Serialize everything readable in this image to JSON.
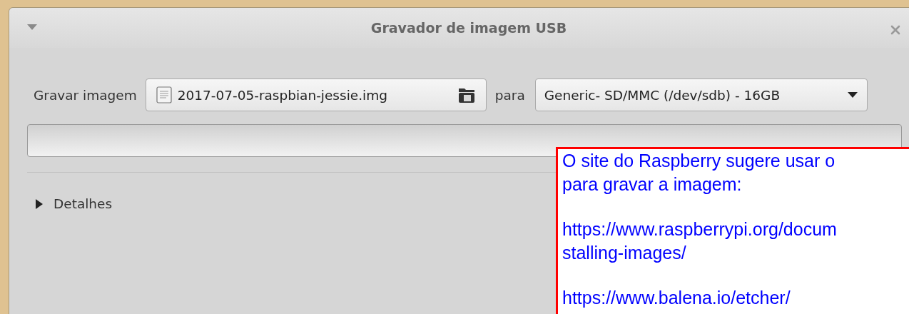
{
  "window": {
    "title": "Gravador de imagem USB"
  },
  "write_row": {
    "label": "Gravar imagem",
    "file": "2017-07-05-raspbian-jessie.img",
    "to_label": "para",
    "device": "Generic- SD/MMC (/dev/sdb) - 16GB"
  },
  "progress": {
    "level": 0
  },
  "details": {
    "label": "Detalhes",
    "expanded": false
  },
  "note": {
    "paragraphs": [
      [
        "O site do Raspberry sugere usar o",
        "para gravar a imagem:"
      ],
      [
        "https://www.raspberrypi.org/docum",
        "stalling-images/"
      ],
      [
        "https://www.balena.io/etcher/"
      ]
    ]
  }
}
